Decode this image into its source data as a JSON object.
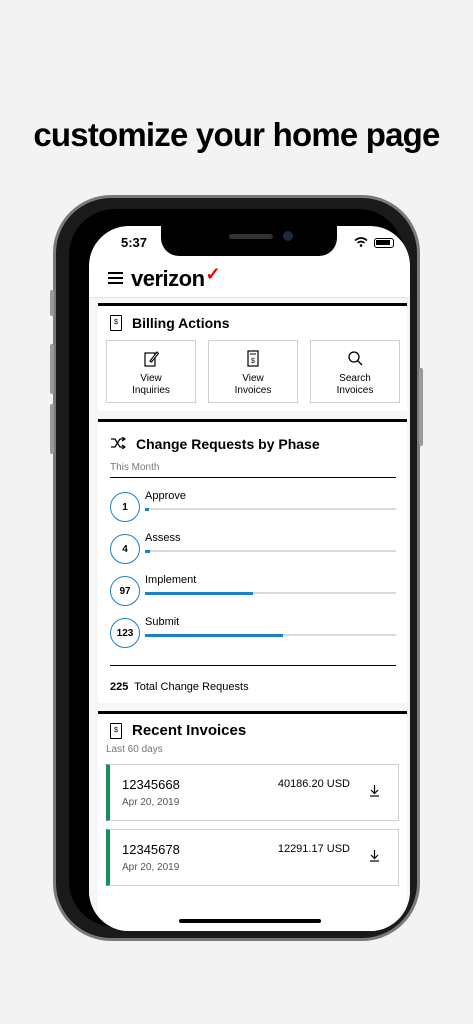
{
  "headline": "customize your home page",
  "status_bar": {
    "time": "5:37"
  },
  "app": {
    "logo": "verizon",
    "logo_mark": "✓"
  },
  "billing_actions": {
    "title": "Billing Actions",
    "actions": [
      {
        "label_line1": "View",
        "label_line2": "Inquiries",
        "icon": "edit-doc-icon"
      },
      {
        "label_line1": "View",
        "label_line2": "Invoices",
        "icon": "invoice-icon"
      },
      {
        "label_line1": "Search",
        "label_line2": "Invoices",
        "icon": "search-icon"
      }
    ]
  },
  "change_requests": {
    "title": "Change Requests by Phase",
    "period": "This Month",
    "phases": [
      {
        "count": "1",
        "label": "Approve",
        "progress": 0.01
      },
      {
        "count": "4",
        "label": "Assess",
        "progress": 0.02
      },
      {
        "count": "97",
        "label": "Implement",
        "progress": 0.43
      },
      {
        "count": "123",
        "label": "Submit",
        "progress": 0.55
      }
    ],
    "total_count": "225",
    "total_label": "Total Change Requests"
  },
  "recent_invoices": {
    "title": "Recent Invoices",
    "period": "Last 60 days",
    "items": [
      {
        "number": "12345668",
        "date": "Apr 20, 2019",
        "amount": "40186.20 USD"
      },
      {
        "number": "12345678",
        "date": "Apr 20, 2019",
        "amount": "12291.17 USD"
      }
    ]
  },
  "colors": {
    "accent_blue": "#1a82c8",
    "invoice_green": "#13915b",
    "brand_red": "#ee0000"
  }
}
